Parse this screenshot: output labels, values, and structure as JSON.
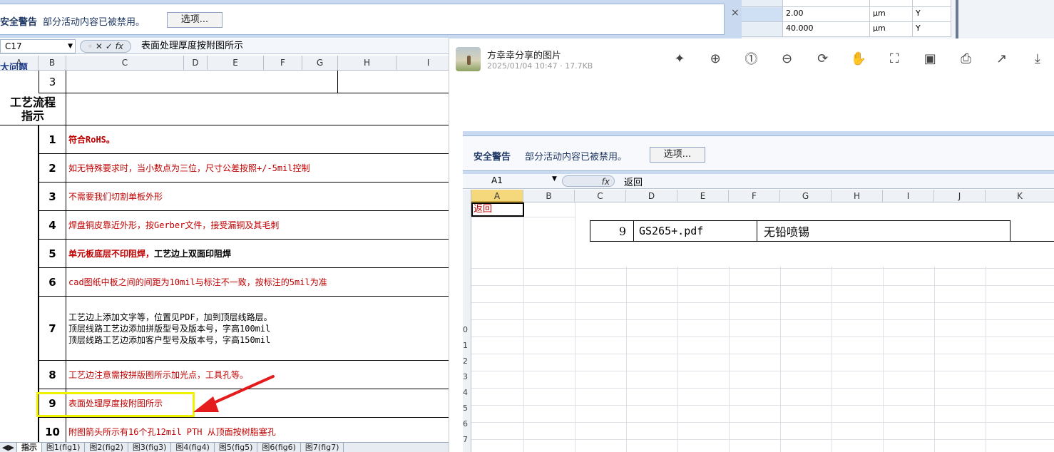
{
  "left_window": {
    "security_bar": {
      "title": "安全警告",
      "message": "部分活动内容已被禁用。",
      "options_label": "选项..."
    },
    "close_glyph": "×",
    "name_box": "C17",
    "fx_label": "fx",
    "formula": "表面处理厚度按附图所示",
    "columns": [
      "A",
      "B",
      "C",
      "D",
      "E",
      "F",
      "G",
      "H",
      "I"
    ],
    "top_fragment": "大问题",
    "row3_value": "3",
    "section_label": "工艺流程\n指示",
    "rows": [
      {
        "num": "1",
        "text": "符合RoHS。"
      },
      {
        "num": "2",
        "text": "如无特殊要求时，当小数点为三位，尺寸公差按照+/-5mil控制"
      },
      {
        "num": "3",
        "text": "不需要我们切割单板外形"
      },
      {
        "num": "4",
        "text": "焊盘铜皮靠近外形，按Gerber文件，接受漏铜及其毛刺"
      },
      {
        "num": "5",
        "text_red": "单元板底层不印阻焊，",
        "text_black": "工艺边上双面印阻焊"
      },
      {
        "num": "6",
        "text": "cad图纸中板之间的间距为10mil与标注不一致，按标注的5mil为准"
      },
      {
        "num": "7",
        "lines": [
          "工艺边上添加文字等，位置见PDF，加到顶层线路层。",
          "顶层线路工艺边添加拼版型号及版本号，字高100mil",
          "顶层线路工艺边添加客户型号及版本号，字高150mil"
        ]
      },
      {
        "num": "8",
        "text": "工艺边注意需按拼版图所示加光点，工具孔等。"
      },
      {
        "num": "9",
        "text": "表面处理厚度按附图所示"
      },
      {
        "num": "10",
        "text": "附图箭头所示有16个孔12mil PTH 从顶面按树脂塞孔"
      }
    ],
    "sheet_tabs": [
      "指示",
      "图1(fig1)",
      "图2(fig2)",
      "图3(fig3)",
      "图4(fig4)",
      "图5(fig5)",
      "图6(fig6)",
      "图7(fig7)"
    ]
  },
  "top_strip": {
    "rows": [
      {
        "value": "2.00",
        "unit": "μm",
        "flag": "Y"
      },
      {
        "value": "40.000",
        "unit": "μm",
        "flag": "Y"
      }
    ]
  },
  "viewer": {
    "title": "方幸幸分享的图片",
    "meta": "2025/01/04 10:47 · 17.7KB",
    "toolbar_icons": [
      "magic-wand-icon",
      "zoom-in-icon",
      "actual-size-icon",
      "zoom-out-icon",
      "rotate-icon",
      "hand-icon",
      "crop-icon",
      "ocr-icon",
      "print-icon",
      "share-icon",
      "download-icon"
    ],
    "toolbar_glyphs": [
      "✦",
      "⊕",
      "⓵",
      "⊖",
      "⟳",
      "✋",
      "⛶",
      "▣",
      "⎙",
      "↗",
      "⤓"
    ],
    "inner_excel": {
      "security_title": "安全警告",
      "security_message": "部分活动内容已被禁用。",
      "options_label": "选项...",
      "name_box": "A1",
      "fx_label": "fx",
      "formula": "返回",
      "columns": [
        "A",
        "B",
        "C",
        "D",
        "E",
        "F",
        "G",
        "H",
        "I",
        "J",
        "K"
      ],
      "a1_value": "返回",
      "row_num": "9",
      "row_file": "GS265+.pdf",
      "row_desc": "无铅喷锡",
      "left_row_digits": [
        "0",
        "1",
        "2",
        "3",
        "4",
        "5",
        "6",
        "7"
      ]
    }
  },
  "colors": {
    "annotation_red": "#e41c1c",
    "highlight_yellow": "#f2f200",
    "text_red": "#c00000"
  }
}
